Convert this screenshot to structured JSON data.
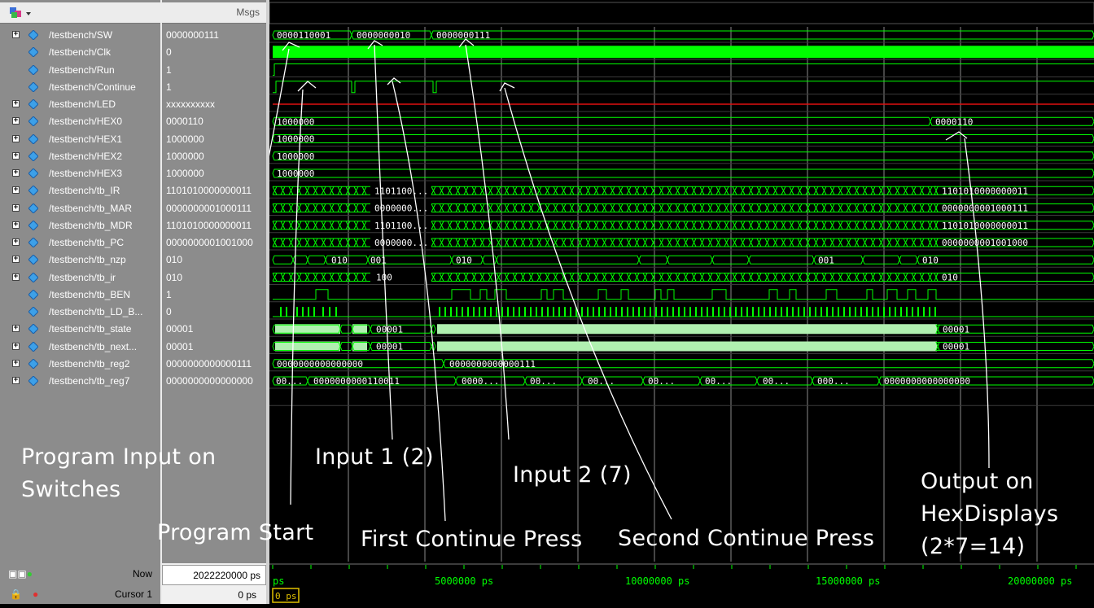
{
  "header": {
    "msgs_label": "Msgs"
  },
  "signals": [
    {
      "name": "/testbench/SW",
      "value": "0000000111",
      "expandable": true
    },
    {
      "name": "/testbench/Clk",
      "value": "0",
      "expandable": false
    },
    {
      "name": "/testbench/Run",
      "value": "1",
      "expandable": false
    },
    {
      "name": "/testbench/Continue",
      "value": "1",
      "expandable": false
    },
    {
      "name": "/testbench/LED",
      "value": "xxxxxxxxxx",
      "expandable": true
    },
    {
      "name": "/testbench/HEX0",
      "value": "0000110",
      "expandable": true
    },
    {
      "name": "/testbench/HEX1",
      "value": "1000000",
      "expandable": true
    },
    {
      "name": "/testbench/HEX2",
      "value": "1000000",
      "expandable": true
    },
    {
      "name": "/testbench/HEX3",
      "value": "1000000",
      "expandable": true
    },
    {
      "name": "/testbench/tb_IR",
      "value": "1101010000000011",
      "expandable": true
    },
    {
      "name": "/testbench/tb_MAR",
      "value": "0000000001000111",
      "expandable": true
    },
    {
      "name": "/testbench/tb_MDR",
      "value": "1101010000000011",
      "expandable": true
    },
    {
      "name": "/testbench/tb_PC",
      "value": "0000000001001000",
      "expandable": true
    },
    {
      "name": "/testbench/tb_nzp",
      "value": "010",
      "expandable": true
    },
    {
      "name": "/testbench/tb_ir",
      "value": "010",
      "expandable": true
    },
    {
      "name": "/testbench/tb_BEN",
      "value": "1",
      "expandable": false
    },
    {
      "name": "/testbench/tb_LD_B...",
      "value": "0",
      "expandable": false
    },
    {
      "name": "/testbench/tb_state",
      "value": "00001",
      "expandable": true
    },
    {
      "name": "/testbench/tb_next...",
      "value": "00001",
      "expandable": true
    },
    {
      "name": "/testbench/tb_reg2",
      "value": "0000000000000111",
      "expandable": true
    },
    {
      "name": "/testbench/tb_reg7",
      "value": "0000000000000000",
      "expandable": true
    }
  ],
  "wave_labels": {
    "sw": [
      "0000110001",
      "0000000010",
      "0000000111"
    ],
    "hex0": [
      "1000000",
      "0000110"
    ],
    "hex1": [
      "1000000"
    ],
    "hex2": [
      "1000000"
    ],
    "hex3": [
      "1000000"
    ],
    "ir": [
      "1101100...",
      "1101010000000011"
    ],
    "mar": [
      "0000000...",
      "0000000001000111"
    ],
    "mdr": [
      "1101100...",
      "1101010000000011"
    ],
    "pc": [
      "0000000...",
      "0000000001001000"
    ],
    "nzp": [
      "010",
      "001",
      "010",
      "001",
      "010"
    ],
    "ir2": [
      "100",
      "010"
    ],
    "state": [
      "00001",
      "00001"
    ],
    "next": [
      "00001",
      "00001"
    ],
    "reg2": [
      "0000000000000000",
      "0000000000000111"
    ],
    "reg7": [
      "00...",
      "0000000000110011",
      "0000...",
      "00...",
      "00...",
      "00...",
      "00...",
      "00...",
      "000...",
      "0000000000000000"
    ]
  },
  "timeline": {
    "now_label": "Now",
    "now_value": "2022220000 ps",
    "cursor_label": "Cursor 1",
    "cursor_value": "0 ps",
    "cursor_marker": "0 ps",
    "ticks": [
      "ps",
      "5000000 ps",
      "10000000 ps",
      "15000000 ps",
      "20000000 ps"
    ]
  },
  "annotations": {
    "program_input": "Program Input on\nSwitches",
    "program_start": "Program Start",
    "input1": "Input 1 (2)",
    "first_continue": "First Continue Press",
    "input2": "Input 2 (7)",
    "second_continue": "Second Continue Press",
    "output": "Output on\nHexDisplays\n(2*7=14)"
  },
  "colors": {
    "wave": "#00ff00",
    "bus_fill": "#b0f0b0",
    "led": "#e01010",
    "panel": "#8c8c8c",
    "grid": "#8a8a8a"
  }
}
